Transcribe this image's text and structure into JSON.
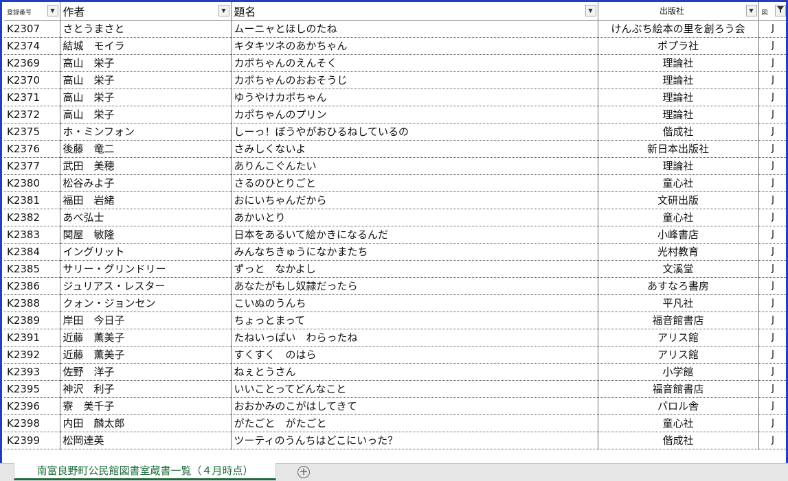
{
  "headers": {
    "col1": "登録番号",
    "col2": "作者",
    "col3": "題名",
    "col4": "出版社",
    "col5": "図"
  },
  "icons": {
    "dropdown": "chevron-down-icon",
    "filter": "filter-icon",
    "add_sheet": "plus-circle-icon"
  },
  "rows": [
    {
      "code": "K2307",
      "author": "さとうまさと",
      "title": "ムーニャとほしのたね",
      "publisher": "けんぶち絵本の里を創ろう会",
      "cat": "J"
    },
    {
      "code": "K2374",
      "author": "結城　モイラ",
      "title": "キタキツネのあかちゃん",
      "publisher": "ポプラ社",
      "cat": "J"
    },
    {
      "code": "K2369",
      "author": "高山　栄子",
      "title": "カポちゃんのえんそく",
      "publisher": "理論社",
      "cat": "J"
    },
    {
      "code": "K2370",
      "author": "高山　栄子",
      "title": "カポちゃんのおおそうじ",
      "publisher": "理論社",
      "cat": "J"
    },
    {
      "code": "K2371",
      "author": "高山　栄子",
      "title": "ゆうやけカポちゃん",
      "publisher": "理論社",
      "cat": "J"
    },
    {
      "code": "K2372",
      "author": "高山　栄子",
      "title": "カポちゃんのプリン",
      "publisher": "理論社",
      "cat": "J"
    },
    {
      "code": "K2375",
      "author": "ホ・ミンフォン",
      "title": "しーっ！ぼうやがおひるねしているの",
      "publisher": "偕成社",
      "cat": "J"
    },
    {
      "code": "K2376",
      "author": "後藤　竜二",
      "title": "さみしくないよ",
      "publisher": "新日本出版社",
      "cat": "J"
    },
    {
      "code": "K2377",
      "author": "武田　美穂",
      "title": "ありんこぐんたい",
      "publisher": "理論社",
      "cat": "J"
    },
    {
      "code": "K2380",
      "author": "松谷みよ子",
      "title": "さるのひとりごと",
      "publisher": "童心社",
      "cat": "J"
    },
    {
      "code": "K2381",
      "author": "福田　岩緒",
      "title": "おにいちゃんだから",
      "publisher": "文研出版",
      "cat": "J"
    },
    {
      "code": "K2382",
      "author": "あべ弘士",
      "title": "あかいとり",
      "publisher": "童心社",
      "cat": "J"
    },
    {
      "code": "K2383",
      "author": "関屋　敏隆",
      "title": "日本をあるいて絵かきになるんだ",
      "publisher": "小峰書店",
      "cat": "J"
    },
    {
      "code": "K2384",
      "author": "イングリット",
      "title": "みんなちきゅうになかまたち",
      "publisher": "光村教育",
      "cat": "J"
    },
    {
      "code": "K2385",
      "author": "サリー・グリンドリー",
      "title": "ずっと　なかよし",
      "publisher": "文溪堂",
      "cat": "J"
    },
    {
      "code": "K2386",
      "author": "ジュリアス・レスター",
      "title": "あなたがもし奴隷だったら",
      "publisher": "あすなろ書房",
      "cat": "J"
    },
    {
      "code": "K2388",
      "author": "クォン・ジョンセン",
      "title": "こいぬのうんち",
      "publisher": "平凡社",
      "cat": "J"
    },
    {
      "code": "K2389",
      "author": "岸田　今日子",
      "title": "ちょっとまって",
      "publisher": "福音館書店",
      "cat": "J"
    },
    {
      "code": "K2391",
      "author": "近藤　薫美子",
      "title": "たねいっぱい　わらったね",
      "publisher": "アリス館",
      "cat": "J"
    },
    {
      "code": "K2392",
      "author": "近藤　薫美子",
      "title": "すくすく　のはら",
      "publisher": "アリス館",
      "cat": "J"
    },
    {
      "code": "K2393",
      "author": "佐野　洋子",
      "title": "ねぇとうさん",
      "publisher": "小学館",
      "cat": "J"
    },
    {
      "code": "K2395",
      "author": "神沢　利子",
      "title": "いいことってどんなこと",
      "publisher": "福音館書店",
      "cat": "J"
    },
    {
      "code": "K2396",
      "author": "寮　美千子",
      "title": "おおかみのこがはしてきて",
      "publisher": "パロル舎",
      "cat": "J"
    },
    {
      "code": "K2398",
      "author": "内田　麟太郎",
      "title": "がたごと　がたごと",
      "publisher": "童心社",
      "cat": "J"
    },
    {
      "code": "K2399",
      "author": "松岡達英",
      "title": "ツーティのうんちはどこにいった？",
      "publisher": "偕成社",
      "cat": "J"
    }
  ],
  "sheet_tab": "南富良野町公民館図書室蔵書一覧（４月時点）"
}
